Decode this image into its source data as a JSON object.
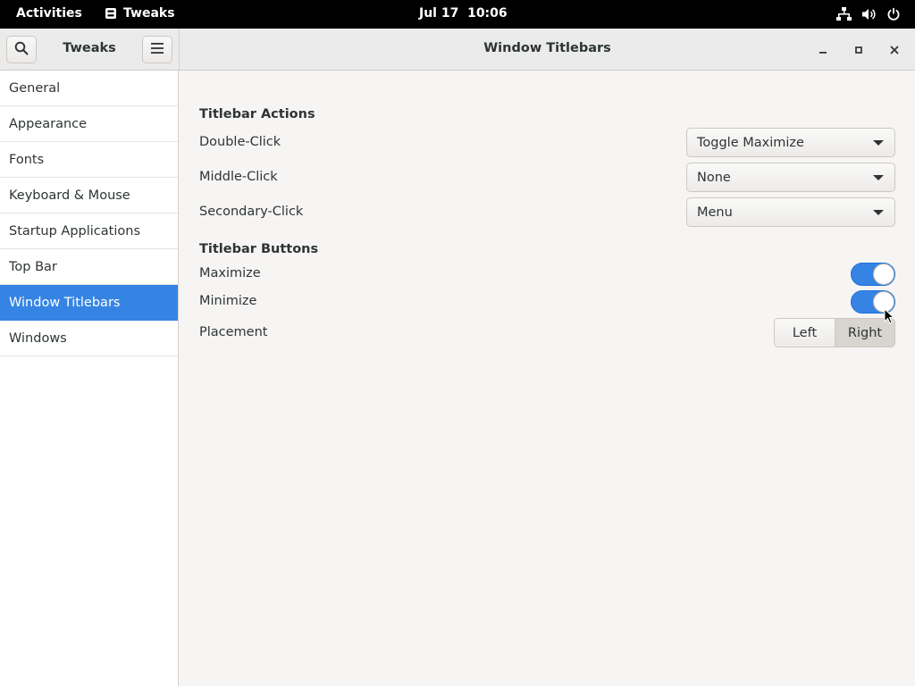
{
  "topbar": {
    "activities": "Activities",
    "app_name": "Tweaks",
    "clock": "Jul 17  10:06",
    "status_icons": [
      "network-icon",
      "volume-icon",
      "power-icon"
    ]
  },
  "header": {
    "sidebar_title": "Tweaks",
    "title": "Window Titlebars"
  },
  "sidebar": {
    "items": [
      {
        "label": "General",
        "active": false
      },
      {
        "label": "Appearance",
        "active": false
      },
      {
        "label": "Fonts",
        "active": false
      },
      {
        "label": "Keyboard & Mouse",
        "active": false
      },
      {
        "label": "Startup Applications",
        "active": false
      },
      {
        "label": "Top Bar",
        "active": false
      },
      {
        "label": "Window Titlebars",
        "active": true
      },
      {
        "label": "Windows",
        "active": false
      }
    ]
  },
  "content": {
    "actions": {
      "title": "Titlebar Actions",
      "double_click": {
        "label": "Double-Click",
        "value": "Toggle Maximize"
      },
      "middle_click": {
        "label": "Middle-Click",
        "value": "None"
      },
      "secondary_click": {
        "label": "Secondary-Click",
        "value": "Menu"
      }
    },
    "buttons": {
      "title": "Titlebar Buttons",
      "maximize": {
        "label": "Maximize",
        "enabled": true
      },
      "minimize": {
        "label": "Minimize",
        "enabled": true
      },
      "placement": {
        "label": "Placement",
        "options": [
          "Left",
          "Right"
        ],
        "selected": "Right"
      }
    }
  },
  "colors": {
    "accent": "#3584e4",
    "topbar_bg": "#000000",
    "window_bg": "#f6f5f4"
  }
}
